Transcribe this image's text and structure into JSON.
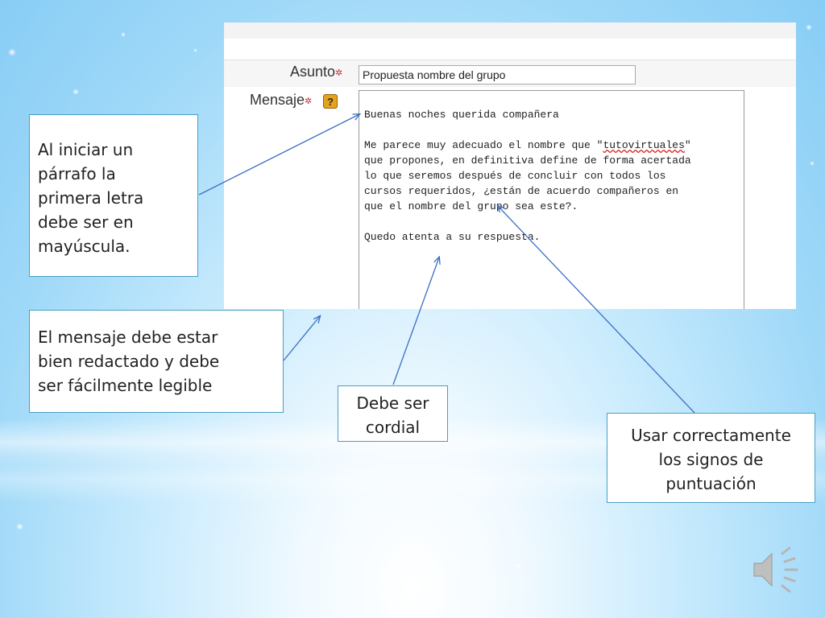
{
  "form": {
    "subject_label": "Asunto",
    "message_label": "Mensaje",
    "required_mark": "✲",
    "help_icon": "question-mark-icon",
    "subject_value": "Propuesta nombre del grupo",
    "message": {
      "greeting": "Buenas noches querida compañera",
      "body_line_1_pre": "Me parece muy adecuado el nombre que \"",
      "body_line_1_word": "tutovirtuales",
      "body_line_1_post": "\"",
      "body_line_2": "que propones, en definitiva define de forma acertada",
      "body_line_3": "lo que seremos después de concluir con todos los",
      "body_line_4": "cursos requeridos, ¿están de acuerdo compañeros en",
      "body_line_5": "que el nombre del grupo sea este?.",
      "closing": "Quedo atenta a su respuesta."
    }
  },
  "callouts": {
    "capital_letter": [
      "Al iniciar un",
      "párrafo la",
      "primera letra",
      "debe ser en",
      "mayúscula."
    ],
    "well_written": [
      "El mensaje debe estar",
      "bien redactado y  debe",
      "ser fácilmente legible"
    ],
    "cordial": [
      "Debe ser",
      "cordial"
    ],
    "punctuation": [
      "Usar correctamente",
      "los  signos de",
      "puntuación"
    ]
  },
  "colors": {
    "callout_border": "#4a9ec4",
    "arrow": "#3b6fc4",
    "required_star": "#cc2a2a",
    "help_icon_fill": "#e6a21c"
  },
  "speaker_icon": "speaker-icon"
}
